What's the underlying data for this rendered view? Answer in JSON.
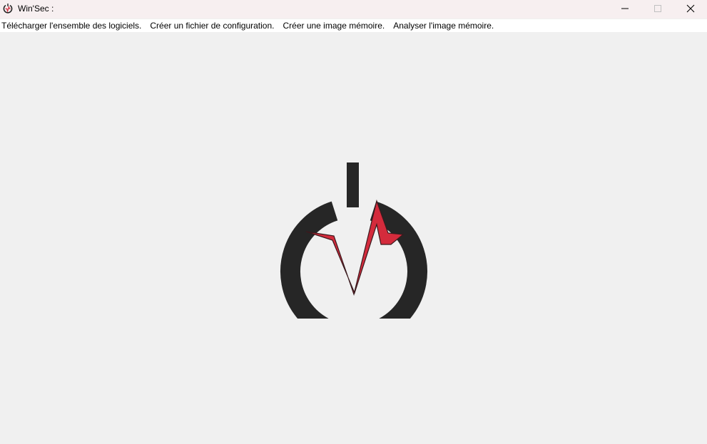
{
  "window": {
    "title": "Win'Sec :",
    "controls": {
      "minimize": "minimize-icon",
      "maximize": "maximize-icon",
      "close": "close-icon"
    }
  },
  "menu": {
    "items": [
      {
        "label": "Télécharger l'ensemble des logiciels."
      },
      {
        "label": "Créer un fichier de configuration."
      },
      {
        "label": "Créer une image mémoire."
      },
      {
        "label": "Analyser l'image mémoire."
      }
    ]
  },
  "logo": {
    "icon": "power-pulse-logo",
    "ring_color": "#262626",
    "pulse_color": "#d42b3c"
  }
}
